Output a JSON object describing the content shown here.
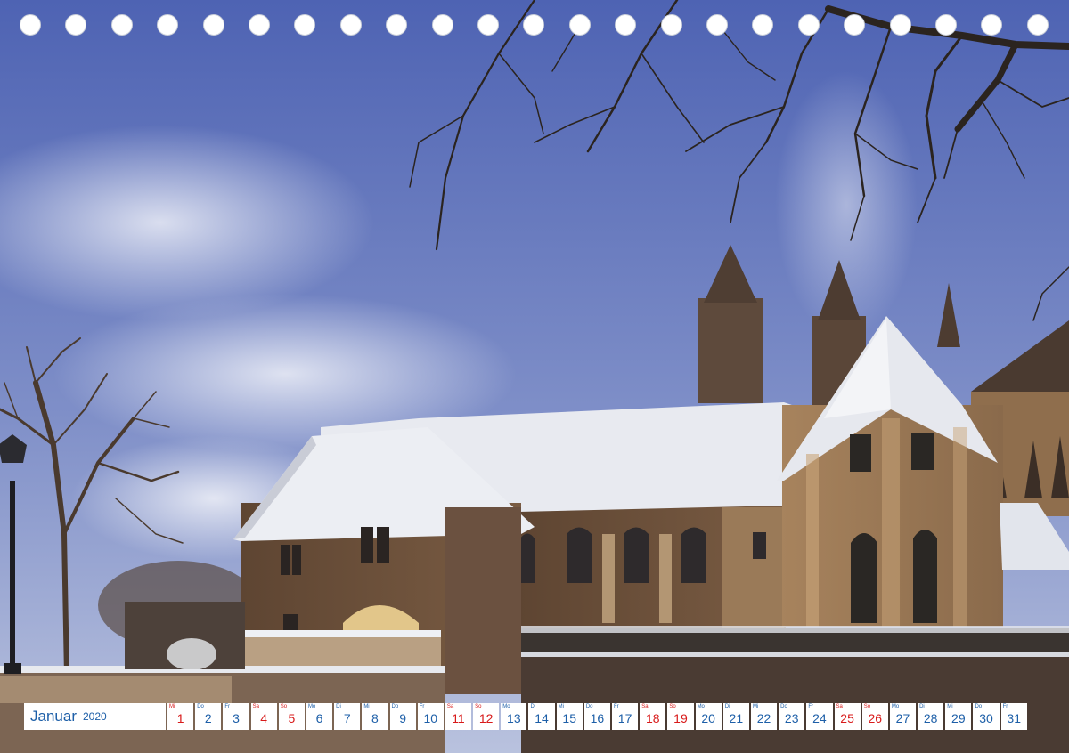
{
  "calendar": {
    "month": "Januar",
    "year": "2020",
    "days": [
      {
        "abbr": "Mi",
        "num": "1",
        "weekend": true
      },
      {
        "abbr": "Do",
        "num": "2",
        "weekend": false
      },
      {
        "abbr": "Fr",
        "num": "3",
        "weekend": false
      },
      {
        "abbr": "Sa",
        "num": "4",
        "weekend": true
      },
      {
        "abbr": "So",
        "num": "5",
        "weekend": true
      },
      {
        "abbr": "Mo",
        "num": "6",
        "weekend": false
      },
      {
        "abbr": "Di",
        "num": "7",
        "weekend": false
      },
      {
        "abbr": "Mi",
        "num": "8",
        "weekend": false
      },
      {
        "abbr": "Do",
        "num": "9",
        "weekend": false
      },
      {
        "abbr": "Fr",
        "num": "10",
        "weekend": false
      },
      {
        "abbr": "Sa",
        "num": "11",
        "weekend": true
      },
      {
        "abbr": "So",
        "num": "12",
        "weekend": true
      },
      {
        "abbr": "Mo",
        "num": "13",
        "weekend": false
      },
      {
        "abbr": "Di",
        "num": "14",
        "weekend": false
      },
      {
        "abbr": "Mi",
        "num": "15",
        "weekend": false
      },
      {
        "abbr": "Do",
        "num": "16",
        "weekend": false
      },
      {
        "abbr": "Fr",
        "num": "17",
        "weekend": false
      },
      {
        "abbr": "Sa",
        "num": "18",
        "weekend": true
      },
      {
        "abbr": "So",
        "num": "19",
        "weekend": true
      },
      {
        "abbr": "Mo",
        "num": "20",
        "weekend": false
      },
      {
        "abbr": "Di",
        "num": "21",
        "weekend": false
      },
      {
        "abbr": "Mi",
        "num": "22",
        "weekend": false
      },
      {
        "abbr": "Do",
        "num": "23",
        "weekend": false
      },
      {
        "abbr": "Fr",
        "num": "24",
        "weekend": false
      },
      {
        "abbr": "Sa",
        "num": "25",
        "weekend": true
      },
      {
        "abbr": "So",
        "num": "26",
        "weekend": true
      },
      {
        "abbr": "Mo",
        "num": "27",
        "weekend": false
      },
      {
        "abbr": "Di",
        "num": "28",
        "weekend": false
      },
      {
        "abbr": "Mi",
        "num": "29",
        "weekend": false
      },
      {
        "abbr": "Do",
        "num": "30",
        "weekend": false
      },
      {
        "abbr": "Fr",
        "num": "31",
        "weekend": false
      }
    ]
  },
  "colors": {
    "weekday": "#1d5fa8",
    "weekend": "#d81a1a",
    "sky_top": "#4e63b3",
    "sky_bottom": "#aeb9da",
    "stone": "#8a6d4f",
    "snow": "#eef0f4"
  },
  "binding_holes": 23
}
